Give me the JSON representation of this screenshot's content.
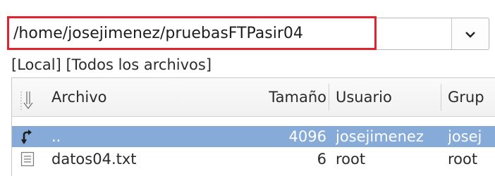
{
  "path": {
    "value": "/home/josejimenez/pruebasFTPasir04",
    "dropdown_icon": "chevron-down-icon"
  },
  "filter": {
    "label": "[Local] [Todos los archivos]"
  },
  "table": {
    "headers": {
      "sort_icon": "sort-toggle-icon",
      "name": "Archivo",
      "size": "Tamaño",
      "user": "Usuario",
      "group": "Grup"
    },
    "rows": [
      {
        "icon": "parent-folder-icon",
        "name": "..",
        "size": "4096",
        "user": "josejimenez",
        "group": "josej",
        "selected": true
      },
      {
        "icon": "text-file-icon",
        "name": "datos04.txt",
        "size": "6",
        "user": "root",
        "group": "root",
        "selected": false
      }
    ]
  },
  "colors": {
    "highlight": "#e0232f",
    "selection": "#86abd9"
  }
}
